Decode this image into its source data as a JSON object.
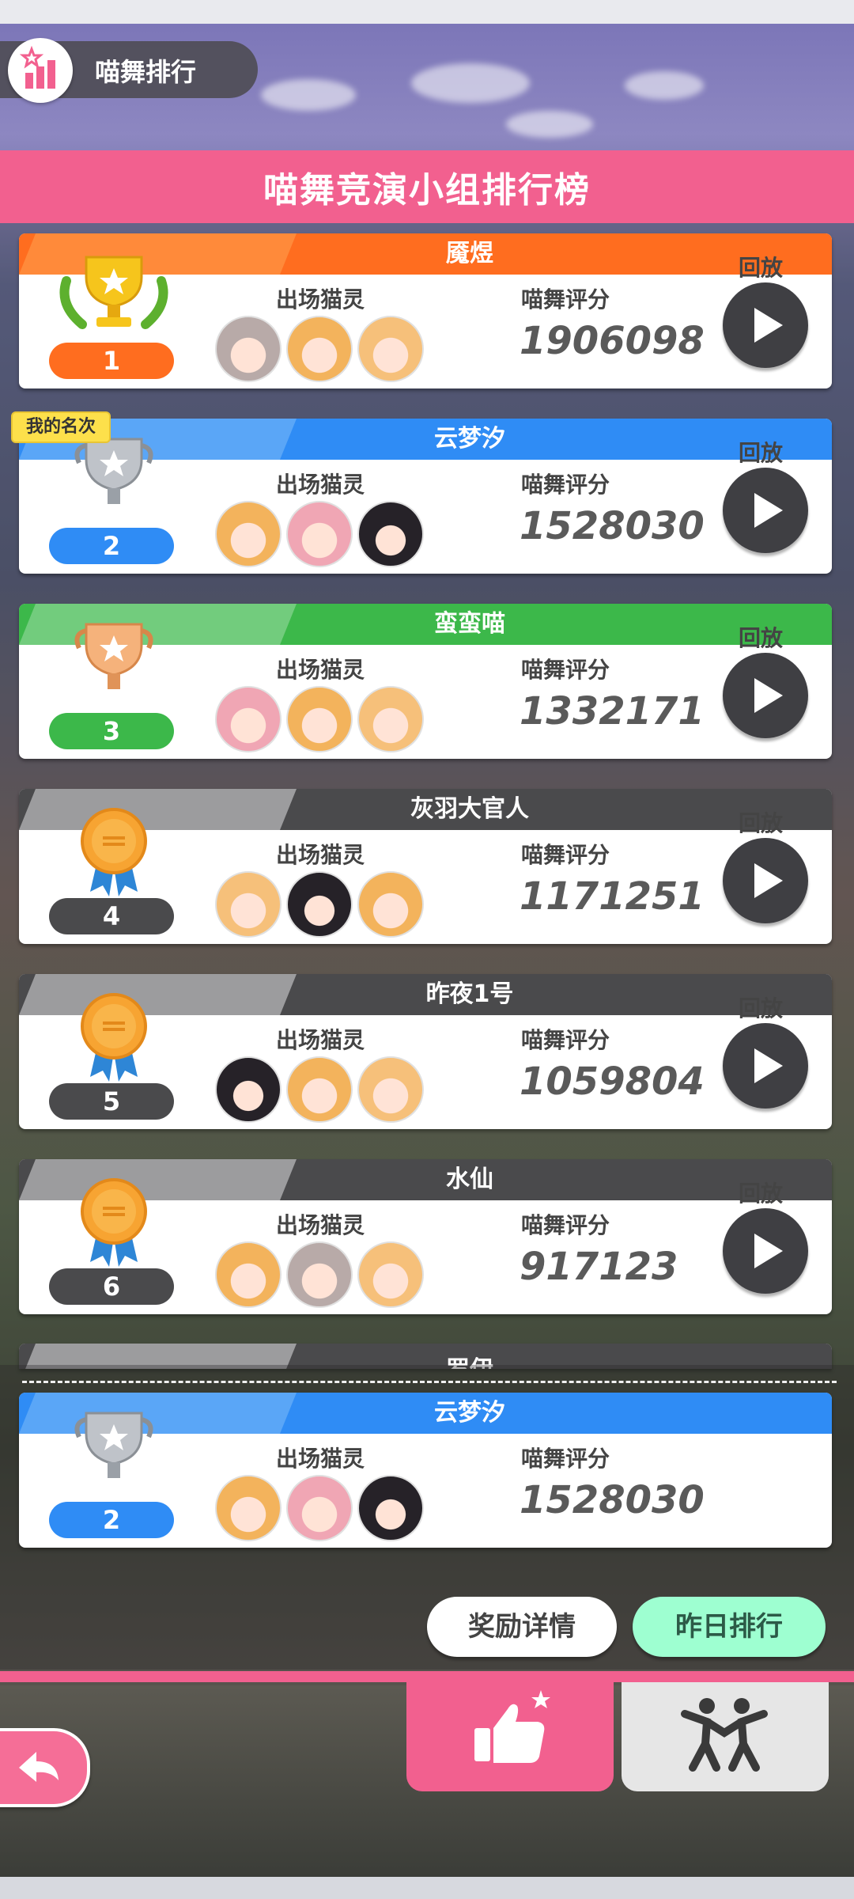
{
  "header": {
    "title": "喵舞排行"
  },
  "banner": {
    "title": "喵舞竞演小组排行榜"
  },
  "labels": {
    "cats": "出场猫灵",
    "score": "喵舞评分",
    "replay": "回放",
    "mine": "我的名次"
  },
  "colors": {
    "pink": "#f2608f",
    "gold": "#ff6d1f",
    "blue": "#2f8cf5",
    "green": "#3cb84a",
    "gray": "#4a4a4c"
  },
  "ranks": [
    {
      "rank": "1",
      "name": "魇煜",
      "score": "1906098",
      "medal": "gold-trophy-icon"
    },
    {
      "rank": "2",
      "name": "云梦汐",
      "score": "1528030",
      "medal": "silver-trophy-icon"
    },
    {
      "rank": "3",
      "name": "蛮蛮喵",
      "score": "1332171",
      "medal": "bronze-trophy-icon"
    },
    {
      "rank": "4",
      "name": "灰羽大官人",
      "score": "1171251",
      "medal": "ribbon-medal-icon"
    },
    {
      "rank": "5",
      "name": "昨夜1号",
      "score": "1059804",
      "medal": "ribbon-medal-icon"
    },
    {
      "rank": "6",
      "name": "水仙",
      "score": "917123",
      "medal": "ribbon-medal-icon"
    }
  ],
  "partial_name": "罗伊",
  "my_rank": {
    "rank": "2",
    "name": "云梦汐",
    "score": "1528030"
  },
  "buttons": {
    "reward": "奖励详情",
    "yesterday": "昨日排行"
  }
}
